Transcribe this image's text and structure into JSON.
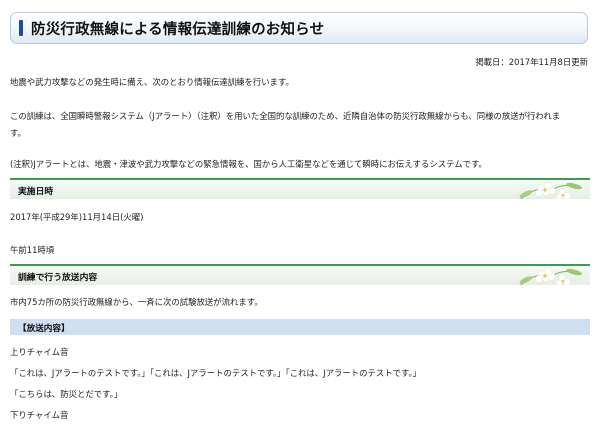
{
  "title": "防災行政無線による情報伝達訓練のお知らせ",
  "posted_date": "掲載日：2017年11月8日更新",
  "intro": "地震や武力攻撃などの発生時に備え、次のとおり情報伝達訓練を行います。",
  "description_line1": "この訓練は、全国瞬時警報システム（Jアラート）（注釈）を用いた全国的な訓練のため、近隣自治体の防災行政無線からも、同様の放送が行われま",
  "description_line2": "す。",
  "note": "(注釈)Jアラートとは、地震・津波や武力攻撃などの緊急情報を、国から人工衛星などを通じて瞬時にお伝えするシステムです。",
  "section_schedule": {
    "heading": "実施日時",
    "date": "2017年(平成29年)11月14日(火曜)",
    "time": "午前11時頃"
  },
  "section_broadcast": {
    "heading": "訓練で行う放送内容",
    "intro": "市内75カ所の防災行政無線から、一斉に次の試験放送が流れます。",
    "subheading": "【放送内容】",
    "chime_start": "上りチャイム音",
    "message_line1": "「これは、Jアラートのテストです。」「これは、Jアラートのテストです。」「これは、Jアラートのテストです。」",
    "message_line2": "「こちらは、防災とだです。」",
    "chime_end": "下りチャイム音"
  }
}
